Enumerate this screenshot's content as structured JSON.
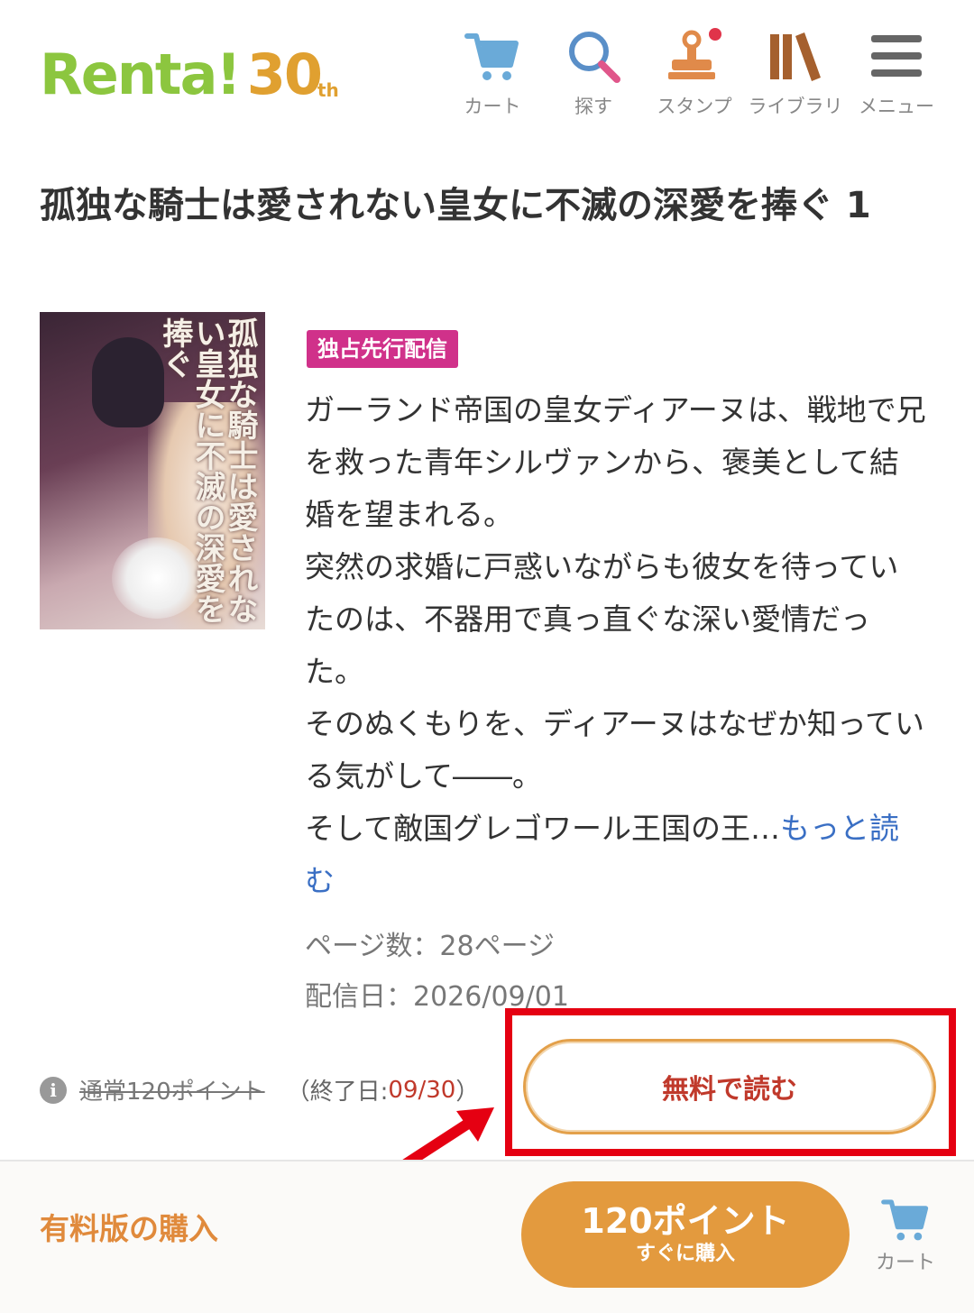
{
  "header": {
    "logo_text": "Renta!",
    "logo_anniv": "30",
    "logo_anniv_suffix": "th",
    "nav": [
      {
        "label": "カート",
        "icon": "cart-icon"
      },
      {
        "label": "探す",
        "icon": "search-icon"
      },
      {
        "label": "スタンプ",
        "icon": "stamp-icon"
      },
      {
        "label": "ライブラリ",
        "icon": "library-icon"
      },
      {
        "label": "メニュー",
        "icon": "menu-icon"
      }
    ]
  },
  "book": {
    "title": "孤独な騎士は愛されない皇女に不滅の深愛を捧ぐ 1",
    "cover_title": "孤独な騎士は愛されない皇女に不滅の深愛を捧ぐ",
    "badge": "独占先行配信",
    "description": [
      "ガーランド帝国の皇女ディアーヌは、戦地で兄を救った青年シルヴァンから、褒美として結婚を望まれる。",
      "突然の求婚に戸惑いながらも彼女を待っていたのは、不器用で真っ直ぐな深い愛情だった。",
      "そのぬくもりを、ディアーヌはなぜか知っている気がして――。",
      "そして敵国グレゴワール王国の王…"
    ],
    "more_link": "もっと読む",
    "pages": "ページ数：28ページ",
    "release_date": "配信日：2026/09/01"
  },
  "pricing": {
    "info_icon": "i",
    "regular_price": "通常120ポイント",
    "end_prefix": "（終了日:",
    "end_date": "09/30",
    "end_suffix": "）",
    "free_button": "無料で読む"
  },
  "bottom_bar": {
    "paid_label": "有料版の購入",
    "buy_points": "120ポイント",
    "buy_now": "すぐに購入",
    "cart_label": "カート"
  },
  "colors": {
    "logo_green": "#8cc63f",
    "logo_orange": "#e0a030",
    "badge_pink": "#d0318a",
    "link_blue": "#3a6fc4",
    "highlight_red": "#e50012",
    "button_orange": "#e39a3e"
  }
}
